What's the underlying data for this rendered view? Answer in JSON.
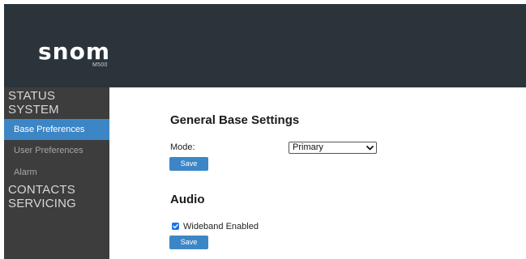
{
  "header": {
    "logo": {
      "word": "snom",
      "model": "M500"
    }
  },
  "sidebar": {
    "sections": [
      {
        "label": "STATUS"
      },
      {
        "label": "SYSTEM",
        "items": [
          {
            "label": "Base Preferences",
            "active": true
          },
          {
            "label": "User Preferences",
            "active": false
          },
          {
            "label": "Alarm",
            "active": false
          }
        ]
      },
      {
        "label": "CONTACTS"
      },
      {
        "label": "SERVICING"
      }
    ]
  },
  "main": {
    "general": {
      "title": "General Base Settings",
      "mode_label": "Mode:",
      "mode_value": "Primary",
      "save_label": "Save"
    },
    "audio": {
      "title": "Audio",
      "wideband_label": "Wideband Enabled",
      "wideband_checked": true,
      "save_label": "Save"
    }
  },
  "colors": {
    "header_bg": "#2b343b",
    "sidebar_bg": "#3d3d3d",
    "accent": "#3d86c6",
    "checkbox": "#1a73e8"
  },
  "icons": {
    "select_arrow": "chevron-down-icon",
    "checkbox_mark": "check-icon"
  }
}
